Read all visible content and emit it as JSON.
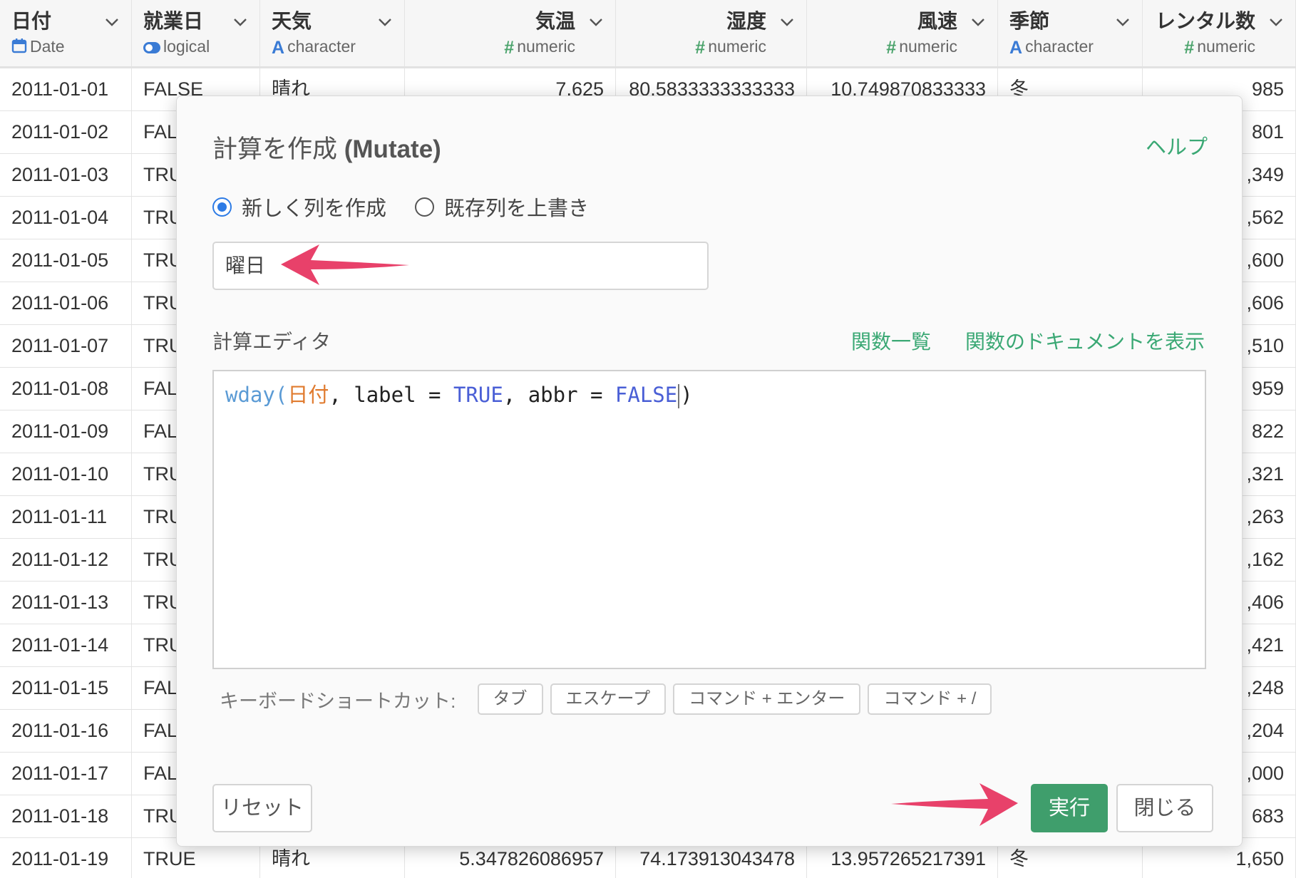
{
  "grid": {
    "columns": [
      {
        "name": "日付",
        "type": "Date",
        "type_icon": "calendar-icon"
      },
      {
        "name": "就業日",
        "type": "logical",
        "type_icon": "toggle-icon"
      },
      {
        "name": "天気",
        "type": "character",
        "type_icon": "A"
      },
      {
        "name": "気温",
        "type": "numeric",
        "type_icon": "#"
      },
      {
        "name": "湿度",
        "type": "numeric",
        "type_icon": "#"
      },
      {
        "name": "風速",
        "type": "numeric",
        "type_icon": "#"
      },
      {
        "name": "季節",
        "type": "character",
        "type_icon": "A"
      },
      {
        "name": "レンタル数",
        "type": "numeric",
        "type_icon": "#"
      }
    ],
    "rows": [
      [
        "2011-01-01",
        "FALSE",
        "晴れ",
        "7.625",
        "80.5833333333333",
        "10.749870833333",
        "冬",
        "985"
      ],
      [
        "2011-01-02",
        "FAL",
        "",
        "",
        "",
        "",
        "",
        "801"
      ],
      [
        "2011-01-03",
        "TRU",
        "",
        "",
        "",
        "",
        "",
        ",349"
      ],
      [
        "2011-01-04",
        "TRU",
        "",
        "",
        "",
        "",
        "",
        ",562"
      ],
      [
        "2011-01-05",
        "TRU",
        "",
        "",
        "",
        "",
        "",
        ",600"
      ],
      [
        "2011-01-06",
        "TRU",
        "",
        "",
        "",
        "",
        "",
        ",606"
      ],
      [
        "2011-01-07",
        "TRU",
        "",
        "",
        "",
        "",
        "",
        ",510"
      ],
      [
        "2011-01-08",
        "FAL",
        "",
        "",
        "",
        "",
        "",
        "959"
      ],
      [
        "2011-01-09",
        "FAL",
        "",
        "",
        "",
        "",
        "",
        "822"
      ],
      [
        "2011-01-10",
        "TRU",
        "",
        "",
        "",
        "",
        "",
        ",321"
      ],
      [
        "2011-01-11",
        "TRU",
        "",
        "",
        "",
        "",
        "",
        ",263"
      ],
      [
        "2011-01-12",
        "TRU",
        "",
        "",
        "",
        "",
        "",
        ",162"
      ],
      [
        "2011-01-13",
        "TRU",
        "",
        "",
        "",
        "",
        "",
        ",406"
      ],
      [
        "2011-01-14",
        "TRU",
        "",
        "",
        "",
        "",
        "",
        ",421"
      ],
      [
        "2011-01-15",
        "FAL",
        "",
        "",
        "",
        "",
        "",
        ",248"
      ],
      [
        "2011-01-16",
        "FAL",
        "",
        "",
        "",
        "",
        "",
        ",204"
      ],
      [
        "2011-01-17",
        "FAL",
        "",
        "",
        "",
        "",
        "",
        ",000"
      ],
      [
        "2011-01-18",
        "TRU",
        "",
        "",
        "",
        "",
        "",
        "683"
      ],
      [
        "2011-01-19",
        "TRUE",
        "晴れ",
        "5.347826086957",
        "74.173913043478",
        "13.957265217391",
        "冬",
        "1,650"
      ]
    ]
  },
  "modal": {
    "title_ja": "計算を作成",
    "title_en": "(Mutate)",
    "help_label": "ヘルプ",
    "radio_new": "新しく列を作成",
    "radio_overwrite": "既存列を上書き",
    "new_column_name": "曜日",
    "editor_label": "計算エディタ",
    "function_list_link": "関数一覧",
    "function_doc_link": "関数のドキュメントを表示",
    "code": {
      "fn": "wday",
      "open": "(",
      "col": "日付",
      "mid1": ", label = ",
      "bool1": "TRUE",
      "mid2": ", abbr = ",
      "bool2": "FALSE",
      "close": ")"
    },
    "shortcuts_label": "キーボードショートカット:",
    "shortcuts": [
      "タブ",
      "エスケープ",
      "コマンド + エンター",
      "コマンド + /"
    ],
    "reset_label": "リセット",
    "run_label": "実行",
    "close_label": "閉じる"
  },
  "colors": {
    "accent_green": "#3f9e6c",
    "link_green": "#3aa874",
    "radio_blue": "#2d7be5",
    "annotation_arrow": "#e8416a"
  }
}
